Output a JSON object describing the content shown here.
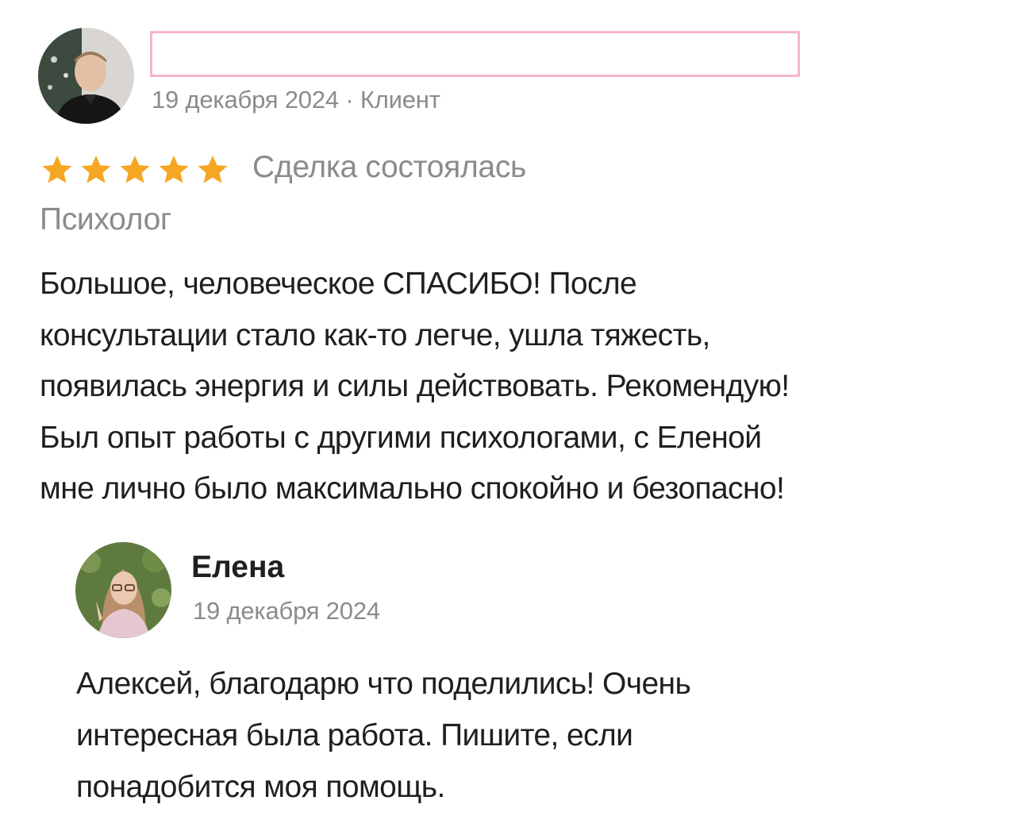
{
  "review": {
    "avatar_icon": "reviewer-photo",
    "name_redacted": "",
    "meta": "19 декабря 2024 · Клиент",
    "rating": 5,
    "rating_max": 5,
    "star_color": "#f5a623",
    "deal_status": "Сделка состоялась",
    "service": "Психолог",
    "text_lines": [
      "Большое, человеческое СПАСИБО! После",
      "консультации стало как-то легче, ушла тяжесть,",
      "появилась энергия и силы действовать. Рекомендую!",
      "Был опыт работы с другими психологами, с Еленой",
      "мне лично было максимально спокойно и безопасно!"
    ]
  },
  "reply": {
    "avatar_icon": "specialist-photo",
    "name": "Елена",
    "date": "19 декабря 2024",
    "text_lines": [
      "Алексей, благодарю что поделились! Очень",
      "интересная была работа. Пишите, если",
      "понадобится моя помощь."
    ]
  },
  "colors": {
    "redaction_border": "#f5b5cf",
    "muted_text": "#8b8b8b",
    "body_text": "#1f1f1f"
  }
}
